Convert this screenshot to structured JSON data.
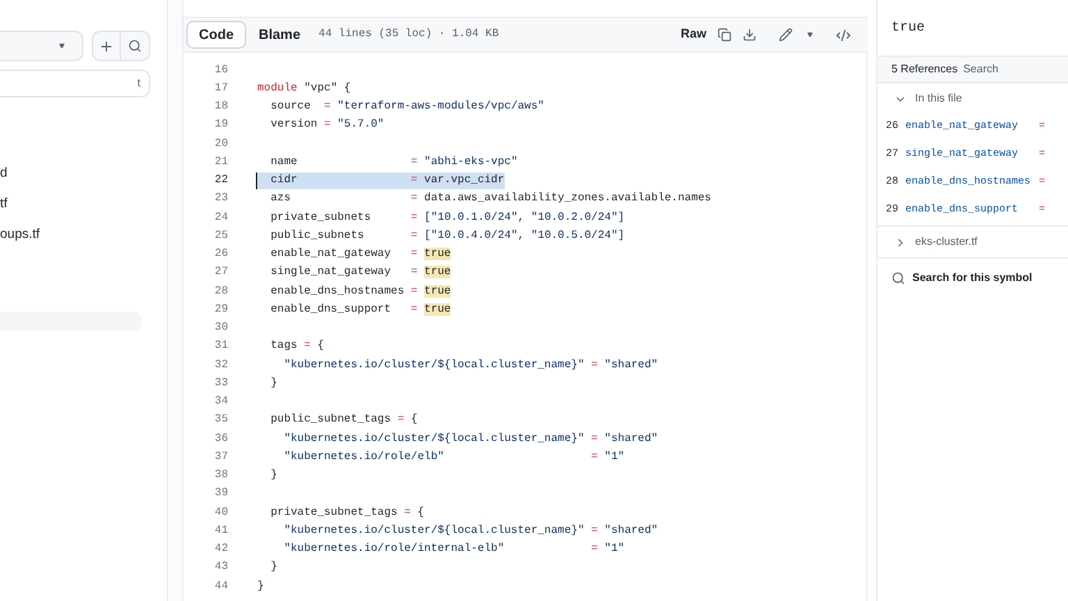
{
  "sidebar": {
    "filter_shortcut": "t",
    "items": [
      {
        "label": "d",
        "selected": false
      },
      {
        "label": "tf",
        "selected": false
      },
      {
        "label": "oups.tf",
        "selected": false
      },
      {
        "selected": true
      }
    ]
  },
  "file_header": {
    "tabs": [
      {
        "label": "Code",
        "selected": true
      },
      {
        "label": "Blame",
        "selected": false
      }
    ],
    "info": "44 lines (35 loc) · 1.04 KB",
    "raw_button": "Raw"
  },
  "code_lines": [
    {
      "n": "16",
      "selected": false
    },
    {
      "n": "17",
      "selected": false,
      "parts": [
        {
          "t": "module",
          "kind": "kw"
        },
        {
          "t": " \"vpc\" {",
          "kind": "plain"
        }
      ]
    },
    {
      "n": "18",
      "selected": false,
      "parts": [
        {
          "t": "  source  ",
          "kind": "plain"
        },
        {
          "t": "=",
          "kind": "op"
        },
        {
          "t": " \"terraform-aws-modules/vpc/aws\"",
          "kind": "str"
        }
      ]
    },
    {
      "n": "19",
      "selected": false,
      "parts": [
        {
          "t": "  version ",
          "kind": "plain"
        },
        {
          "t": "=",
          "kind": "op"
        },
        {
          "t": " \"5.7.0\"",
          "kind": "str"
        }
      ]
    },
    {
      "n": "20",
      "selected": false
    },
    {
      "n": "21",
      "selected": false,
      "parts": [
        {
          "t": "  name                 ",
          "kind": "plain"
        },
        {
          "t": "=",
          "kind": "op"
        },
        {
          "t": " \"abhi-eks-vpc\"",
          "kind": "str"
        }
      ]
    },
    {
      "n": "22",
      "selected": true,
      "parts": [
        {
          "t": "  cidr                 ",
          "kind": "plain"
        },
        {
          "t": "=",
          "kind": "op"
        },
        {
          "t": " var.vpc_cidr",
          "kind": "plain"
        }
      ]
    },
    {
      "n": "23",
      "selected": false,
      "parts": [
        {
          "t": "  azs                  ",
          "kind": "plain"
        },
        {
          "t": "=",
          "kind": "op"
        },
        {
          "t": " data.aws_availability_zones.available.names",
          "kind": "plain"
        }
      ]
    },
    {
      "n": "24",
      "selected": false,
      "parts": [
        {
          "t": "  private_subnets      ",
          "kind": "plain"
        },
        {
          "t": "=",
          "kind": "op"
        },
        {
          "t": " [\"10.0.1.0/24\", \"10.0.2.0/24\"]",
          "kind": "str"
        }
      ]
    },
    {
      "n": "25",
      "selected": false,
      "parts": [
        {
          "t": "  public_subnets       ",
          "kind": "plain"
        },
        {
          "t": "=",
          "kind": "op"
        },
        {
          "t": " [\"10.0.4.0/24\", \"10.0.5.0/24\"]",
          "kind": "str"
        }
      ]
    },
    {
      "n": "26",
      "selected": false,
      "parts": [
        {
          "t": "  enable_nat_gateway   ",
          "kind": "plain"
        },
        {
          "t": "= ",
          "kind": "op"
        },
        {
          "t": "true",
          "kind": "match"
        }
      ]
    },
    {
      "n": "27",
      "selected": false,
      "parts": [
        {
          "t": "  single_nat_gateway   ",
          "kind": "plain"
        },
        {
          "t": "= ",
          "kind": "op"
        },
        {
          "t": "true",
          "kind": "match"
        }
      ]
    },
    {
      "n": "28",
      "selected": false,
      "parts": [
        {
          "t": "  enable_dns_hostnames ",
          "kind": "plain"
        },
        {
          "t": "= ",
          "kind": "op"
        },
        {
          "t": "true",
          "kind": "match"
        }
      ]
    },
    {
      "n": "29",
      "selected": false,
      "parts": [
        {
          "t": "  enable_dns_support   ",
          "kind": "plain"
        },
        {
          "t": "= ",
          "kind": "op"
        },
        {
          "t": "true",
          "kind": "match"
        }
      ]
    },
    {
      "n": "30",
      "selected": false
    },
    {
      "n": "31",
      "selected": false,
      "parts": [
        {
          "t": "  tags ",
          "kind": "plain"
        },
        {
          "t": "=",
          "kind": "op"
        },
        {
          "t": " {",
          "kind": "plain"
        }
      ]
    },
    {
      "n": "32",
      "selected": false,
      "parts": [
        {
          "t": "    \"kubernetes.io/cluster/${local.cluster_name}\" ",
          "kind": "str"
        },
        {
          "t": "=",
          "kind": "op"
        },
        {
          "t": " \"shared\"",
          "kind": "str"
        }
      ]
    },
    {
      "n": "33",
      "selected": false,
      "parts": [
        {
          "t": "  }",
          "kind": "plain"
        }
      ]
    },
    {
      "n": "34",
      "selected": false
    },
    {
      "n": "35",
      "selected": false,
      "parts": [
        {
          "t": "  public_subnet_tags ",
          "kind": "plain"
        },
        {
          "t": "=",
          "kind": "op"
        },
        {
          "t": " {",
          "kind": "plain"
        }
      ]
    },
    {
      "n": "36",
      "selected": false,
      "parts": [
        {
          "t": "    \"kubernetes.io/cluster/${local.cluster_name}\" ",
          "kind": "str"
        },
        {
          "t": "=",
          "kind": "op"
        },
        {
          "t": " \"shared\"",
          "kind": "str"
        }
      ]
    },
    {
      "n": "37",
      "selected": false,
      "parts": [
        {
          "t": "    \"kubernetes.io/role/elb\"                      ",
          "kind": "str"
        },
        {
          "t": "=",
          "kind": "op"
        },
        {
          "t": " \"1\"",
          "kind": "str"
        }
      ]
    },
    {
      "n": "38",
      "selected": false,
      "parts": [
        {
          "t": "  }",
          "kind": "plain"
        }
      ]
    },
    {
      "n": "39",
      "selected": false
    },
    {
      "n": "40",
      "selected": false,
      "parts": [
        {
          "t": "  private_subnet_tags ",
          "kind": "plain"
        },
        {
          "t": "=",
          "kind": "op"
        },
        {
          "t": " {",
          "kind": "plain"
        }
      ]
    },
    {
      "n": "41",
      "selected": false,
      "parts": [
        {
          "t": "    \"kubernetes.io/cluster/${local.cluster_name}\" ",
          "kind": "str"
        },
        {
          "t": "=",
          "kind": "op"
        },
        {
          "t": " \"shared\"",
          "kind": "str"
        }
      ]
    },
    {
      "n": "42",
      "selected": false,
      "parts": [
        {
          "t": "    \"kubernetes.io/role/internal-elb\"             ",
          "kind": "str"
        },
        {
          "t": "=",
          "kind": "op"
        },
        {
          "t": " \"1\"",
          "kind": "str"
        }
      ]
    },
    {
      "n": "43",
      "selected": false,
      "parts": [
        {
          "t": "  }",
          "kind": "plain"
        }
      ]
    },
    {
      "n": "44",
      "selected": false,
      "parts": [
        {
          "t": "}",
          "kind": "plain"
        }
      ]
    }
  ],
  "symbol_panel": {
    "symbol": "true",
    "references_count": "5 References",
    "search_tab": "Search",
    "groups": [
      {
        "label": "In this file",
        "expanded": true,
        "refs": [
          {
            "line": "26",
            "name": "enable_nat_gateway",
            "rest": "="
          },
          {
            "line": "27",
            "name": "single_nat_gateway",
            "rest": "="
          },
          {
            "line": "28",
            "name": "enable_dns_hostnames",
            "rest": "="
          },
          {
            "line": "29",
            "name": "enable_dns_support",
            "rest": "="
          }
        ]
      },
      {
        "label": "eks-cluster.tf",
        "expanded": false
      }
    ],
    "search_symbol": "Search for this symbol"
  }
}
